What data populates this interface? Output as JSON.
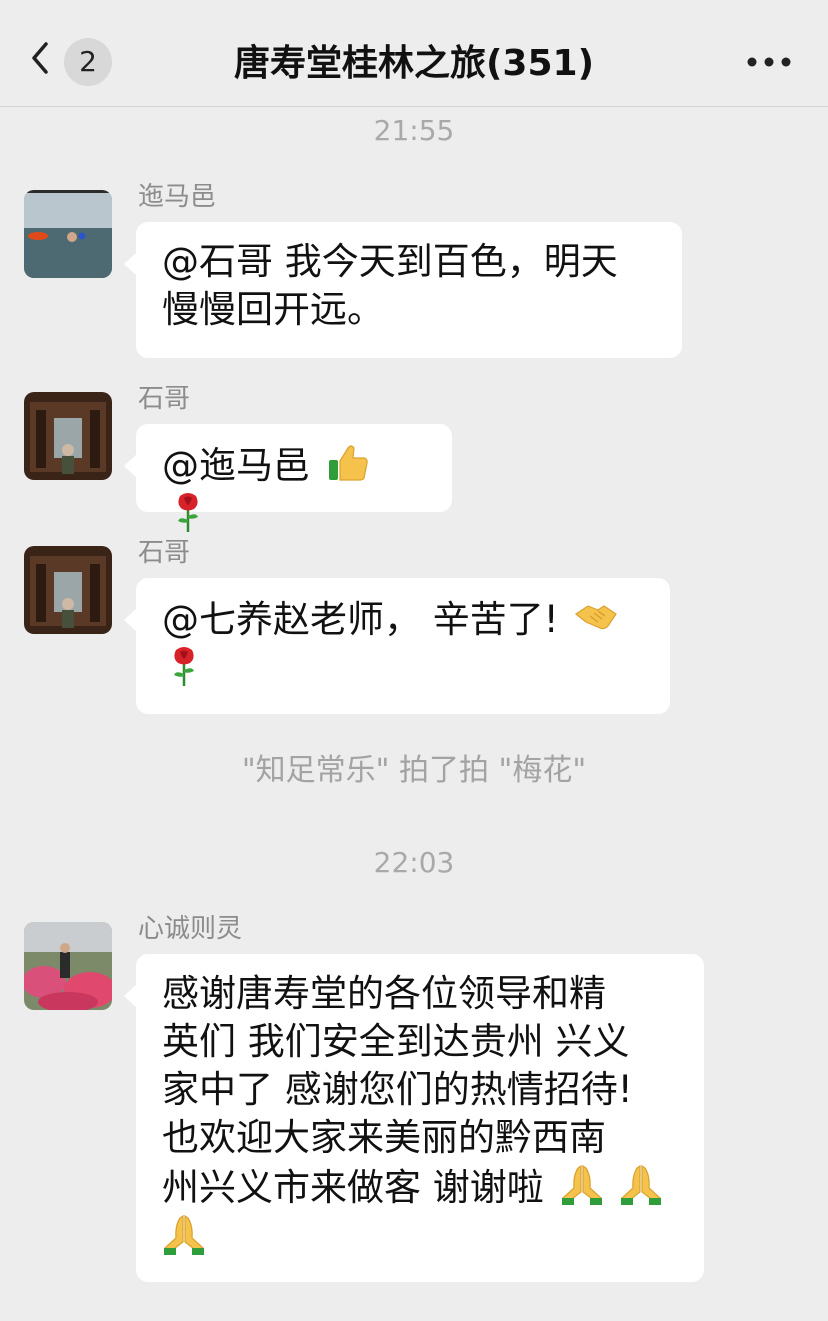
{
  "header": {
    "back_icon": "chevron-left-icon",
    "unread_count": "2",
    "title": "唐寿堂桂林之旅(351)",
    "more_icon": "more-dots-icon"
  },
  "timestamps": [
    "21:55",
    "22:03"
  ],
  "messages": [
    {
      "sender": "迤马邑",
      "lines": [
        "@石哥 我今天到百色，明天",
        "慢慢回开远。"
      ]
    },
    {
      "sender": "石哥",
      "text": "@迤马邑",
      "emojis": [
        "thumbs-up-icon",
        "rose-icon"
      ]
    },
    {
      "sender": "石哥",
      "text": "@七养赵老师， 辛苦了!",
      "emojis": [
        "handshake-icon",
        "rose-icon"
      ]
    },
    {
      "sender": "心诚则灵",
      "lines": [
        "感谢唐寿堂的各位领导和精",
        "英们 我们安全到达贵州 兴义",
        "家中了 感谢您们的热情招待!",
        "也欢迎大家来美丽的黔西南",
        "州兴义市来做客 谢谢啦"
      ],
      "emojis": [
        "pray-icon",
        "pray-icon",
        "pray-icon"
      ]
    }
  ],
  "system_message": "\"知足常乐\" 拍了拍 \"梅花\"",
  "colors": {
    "background": "#ededed",
    "bubble": "#ffffff",
    "meta_text": "#a9a9a9"
  }
}
